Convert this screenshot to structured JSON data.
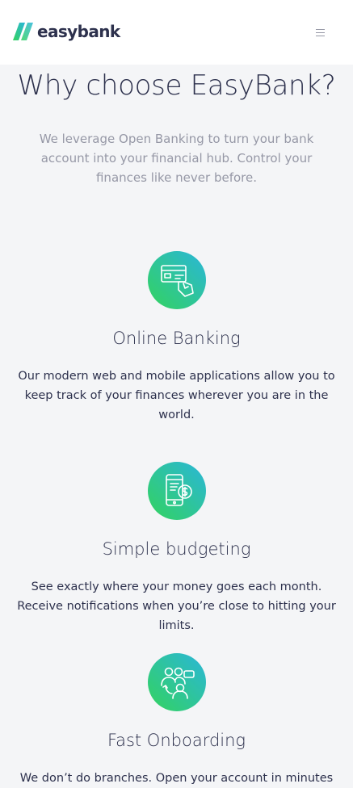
{
  "header": {
    "brand": "easybank",
    "menu_icon": "hamburger-menu-icon"
  },
  "colors": {
    "lime": "#31d35c",
    "cyan": "#2bb7da",
    "dark_blue": "#2d314d",
    "grayish_blue": "#9698a6",
    "light_bg": "#f4f5f7"
  },
  "main": {
    "title": "Why choose EasyBank?",
    "intro": "We leverage Open Banking to turn your bank account into your financial hub. Control your finances like never before.",
    "features": [
      {
        "icon": "online-banking-icon",
        "title": "Online Banking",
        "text": "Our modern web and mobile applications allow you to keep track of your finances wherever you are in the world."
      },
      {
        "icon": "budgeting-icon",
        "title": "Simple budgeting",
        "text": "See exactly where your money goes each month. Receive notifications when you’re close to hitting your limits."
      },
      {
        "icon": "onboarding-icon",
        "title": "Fast Onboarding",
        "text": "We don’t do branches. Open your account in minutes"
      }
    ]
  }
}
